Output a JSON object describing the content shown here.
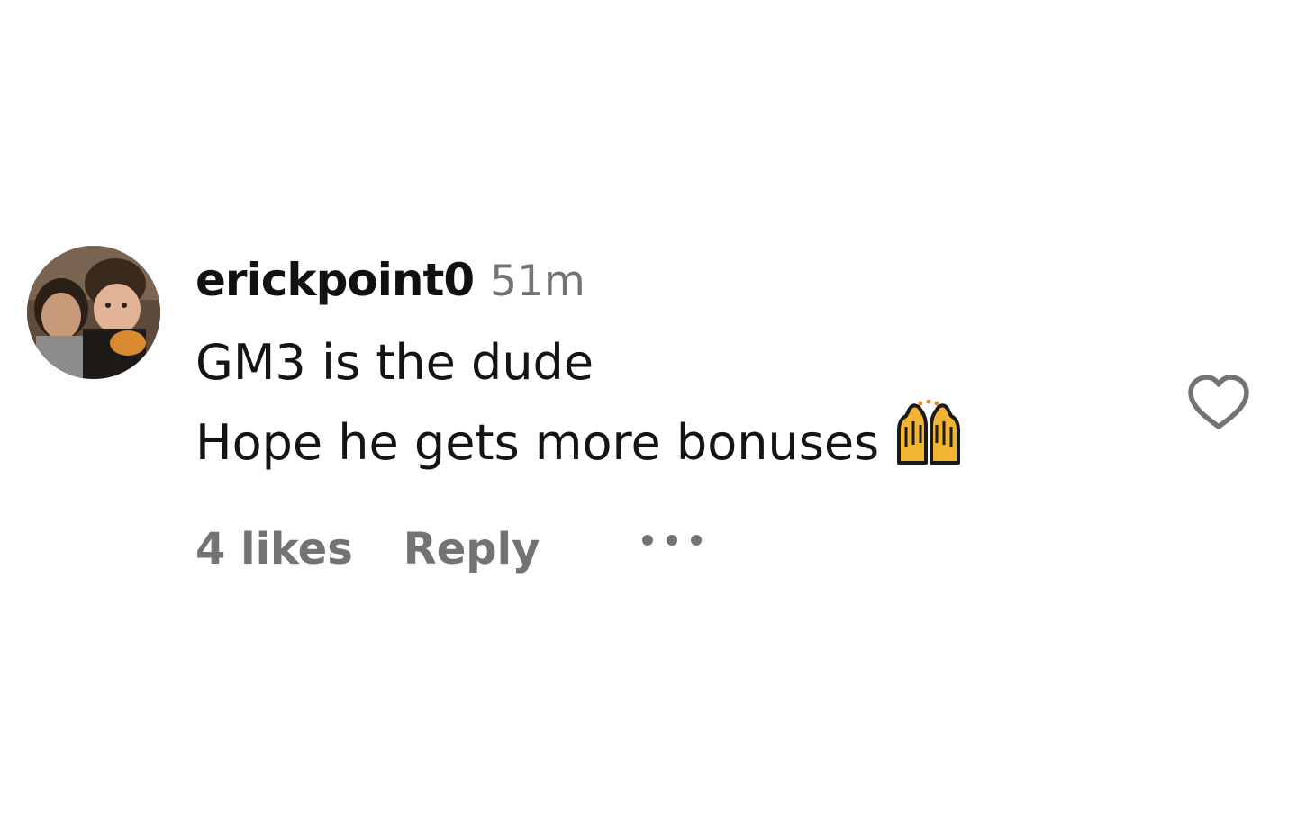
{
  "comment": {
    "username": "erickpoint0",
    "timestamp": "51m",
    "lines": [
      "GM3 is the dude",
      "Hope he gets more bonuses"
    ],
    "emoji": "raising-hands-emoji",
    "likes_label": "4 likes",
    "reply_label": "Reply",
    "more_icon": "more-options-icon",
    "like_icon": "heart-outline-icon",
    "avatar": "user-avatar-photo"
  },
  "colors": {
    "username": "#111111",
    "secondary_text": "#737373",
    "body_text": "#141414",
    "background": "#ffffff",
    "heart_stroke": "#737373",
    "emoji_yellow": "#f2b531"
  }
}
